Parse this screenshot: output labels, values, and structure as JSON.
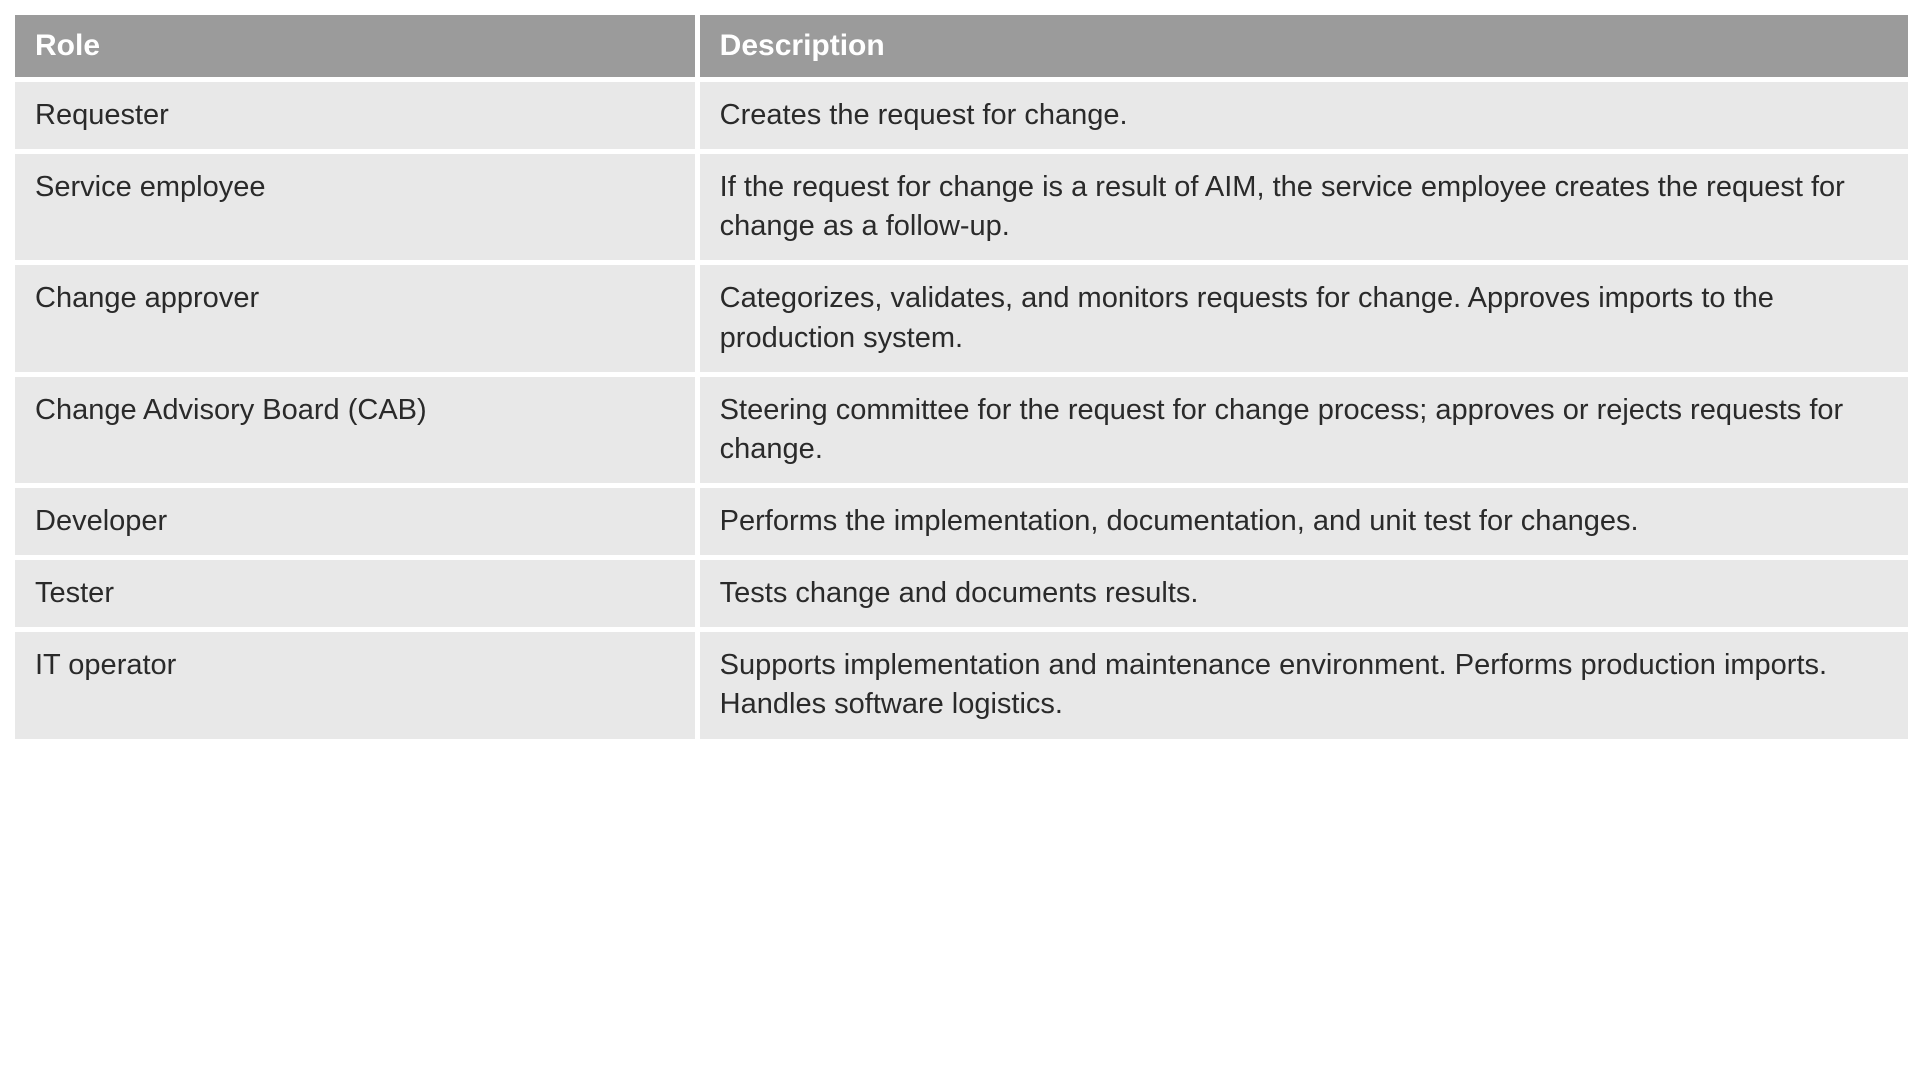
{
  "table": {
    "headers": {
      "role": "Role",
      "description": "Description"
    },
    "rows": [
      {
        "role": "Requester",
        "description": "Creates the request for change."
      },
      {
        "role": "Service employee",
        "description": "If the request for change is a result of AIM, the service employee creates the request for change as a follow-up."
      },
      {
        "role": "Change approver",
        "description": "Categorizes, validates, and monitors requests for change. Approves imports to the production system."
      },
      {
        "role": "Change Advisory Board (CAB)",
        "description": "Steering committee for the request for change process; approves or rejects requests for change."
      },
      {
        "role": "Developer",
        "description": "Performs the implementation, documentation, and unit test for changes."
      },
      {
        "role": "Tester",
        "description": "Tests change and documents results."
      },
      {
        "role": "IT operator",
        "description": "Supports implementation and maintenance environ­ment. Performs production imports. Handles soft­ware logistics."
      }
    ]
  }
}
